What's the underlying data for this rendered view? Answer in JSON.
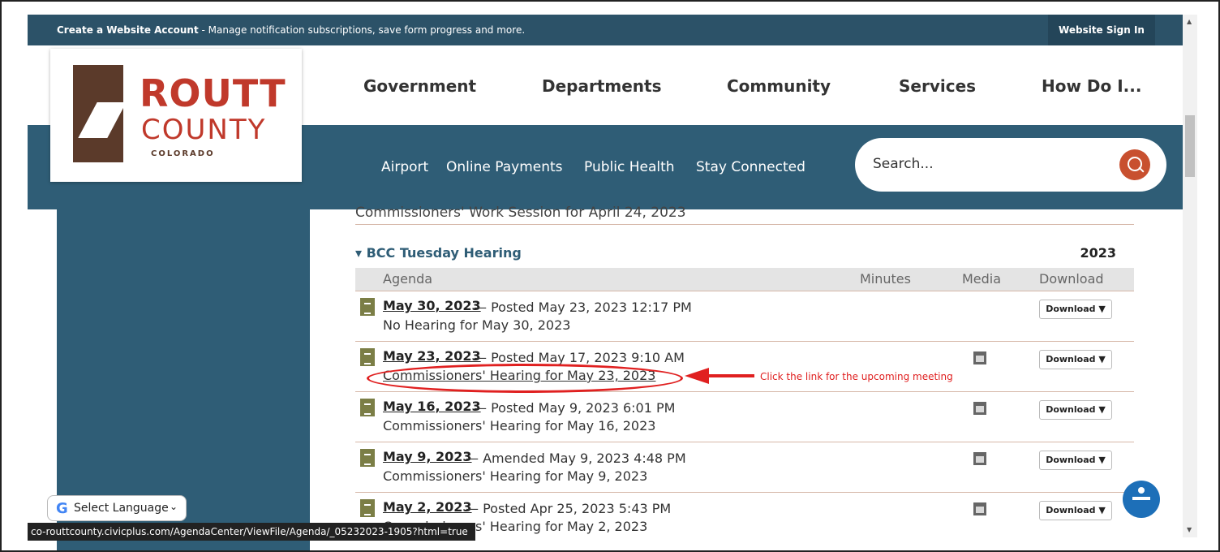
{
  "topbar": {
    "account_bold": "Create a Website Account",
    "account_text": " - Manage notification subscriptions, save form progress and more.",
    "signin": "Website Sign In"
  },
  "logo": {
    "name1": "ROUTT",
    "name2": "COUNTY",
    "state": "COLORADO"
  },
  "mainnav": [
    "Government",
    "Departments",
    "Community",
    "Services",
    "How Do I..."
  ],
  "subnav": [
    "Airport",
    "Online Payments",
    "Public Health",
    "Stay Connected"
  ],
  "search": {
    "placeholder": "Search..."
  },
  "prev_row": "Commissioners' Work Session for April 24, 2023",
  "category": {
    "name": "BCC Tuesday Hearing",
    "year": "2023"
  },
  "columns": {
    "agenda": "Agenda",
    "minutes": "Minutes",
    "media": "Media",
    "download": "Download"
  },
  "rows": [
    {
      "date": "May 30, 2023",
      "posted": " — Posted May 23, 2023 12:17 PM",
      "title": "No Hearing for May 30, 2023",
      "download": "Download ▼"
    },
    {
      "date": "May 23, 2023",
      "posted": " — Posted May 17, 2023 9:10 AM",
      "title": "Commissioners' Hearing for May 23, 2023",
      "download": "Download ▼"
    },
    {
      "date": "May 16, 2023",
      "posted": " — Posted May 9, 2023 6:01 PM",
      "title": "Commissioners' Hearing for May 16, 2023",
      "download": "Download ▼"
    },
    {
      "date": "May 9, 2023",
      "posted": " — Amended May 9, 2023 4:48 PM",
      "title": "Commissioners' Hearing for May 9, 2023",
      "download": "Download ▼"
    },
    {
      "date": "May 2, 2023",
      "posted": " — Posted Apr 25, 2023 5:43 PM",
      "title": "Commissioners' Hearing for May 2, 2023",
      "download": "Download ▼"
    }
  ],
  "annotation": "Click the link for the upcoming meeting",
  "language": {
    "label": "Select Language"
  },
  "statusbar": "co-routtcounty.civicplus.com/AgendaCenter/ViewFile/Agenda/_05232023-1905?html=true",
  "colors": {
    "header": "#2c5268",
    "subnav": "#2f5d76",
    "accent": "#c8502f",
    "annotation": "#e02020"
  }
}
